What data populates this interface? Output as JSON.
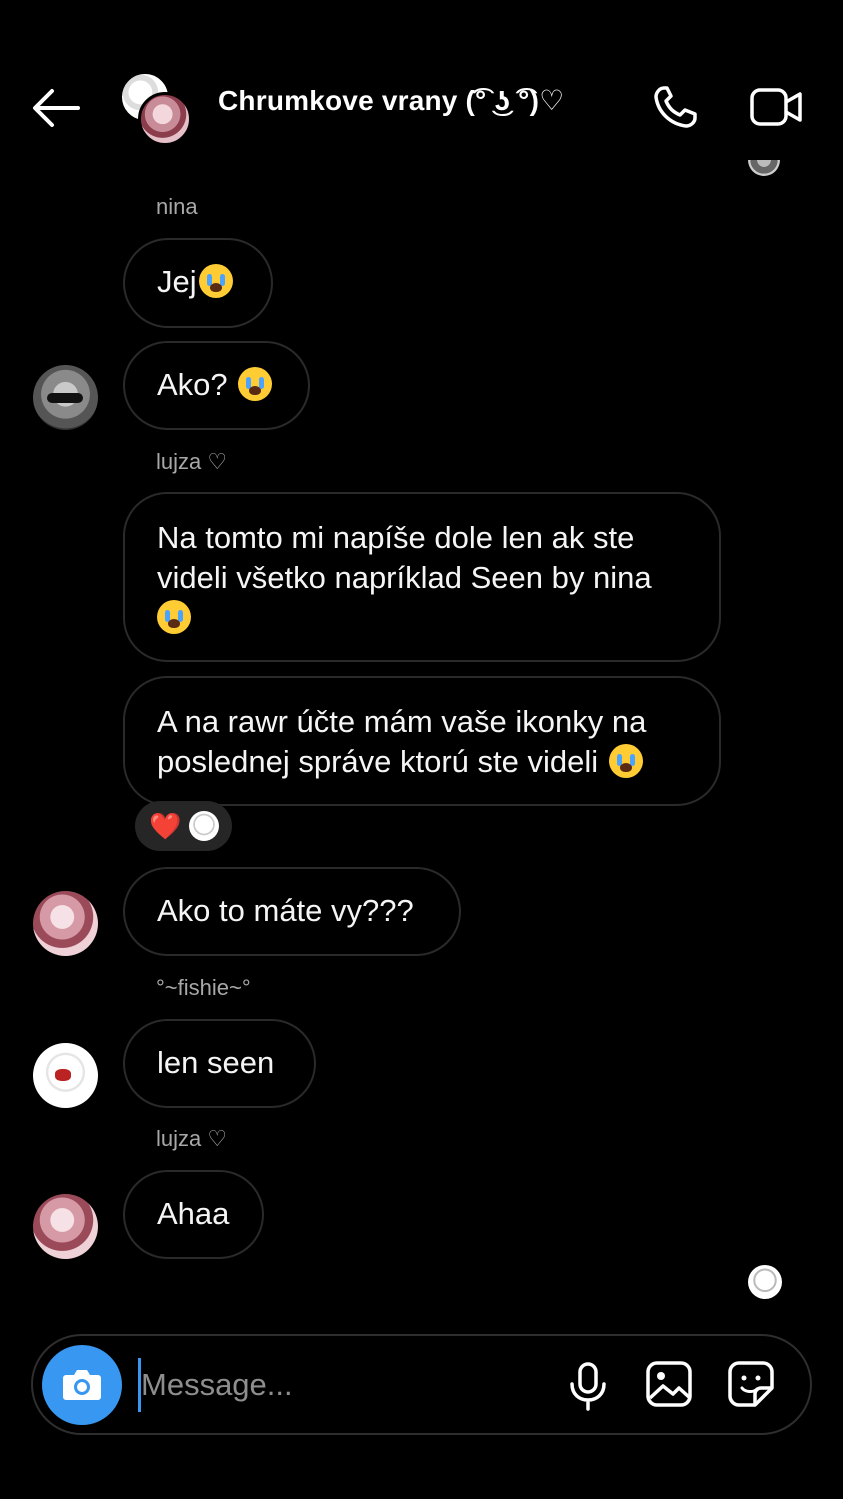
{
  "header": {
    "title": "Chrumkove vrany (͡° ͜ʖ ͡°)♡",
    "back_icon": "arrow-left-icon",
    "call_icon": "phone-icon",
    "video_icon": "video-camera-icon"
  },
  "messages": [
    {
      "sender": "nina",
      "text": "Jej",
      "emoji": "loudly-crying-face"
    },
    {
      "sender": "",
      "text": "Ako? ",
      "emoji": "loudly-crying-face"
    },
    {
      "sender": "lujza ♡",
      "text": "Na tomto mi napíše dole len ak ste videli všetko napríklad Seen by nina",
      "emoji": "loudly-crying-face"
    },
    {
      "sender": "",
      "text": "A na rawr účte mám vaše ikonky na poslednej správe ktorú ste videli ",
      "emoji": "loudly-crying-face",
      "reaction": "❤️"
    },
    {
      "sender": "",
      "text": "Ako to máte vy???"
    },
    {
      "sender": "°~fishie~°",
      "text": "len seen"
    },
    {
      "sender": "lujza ♡",
      "text": "Ahaa"
    }
  ],
  "composer": {
    "placeholder": "Message...",
    "camera_icon": "camera-icon",
    "mic_icon": "microphone-icon",
    "gallery_icon": "image-gallery-icon",
    "sticker_icon": "sticker-icon"
  },
  "colors": {
    "background": "#000000",
    "accent": "#3897f0",
    "bubble_border": "#2a2a2a",
    "sender_text": "#a8a8a8"
  }
}
